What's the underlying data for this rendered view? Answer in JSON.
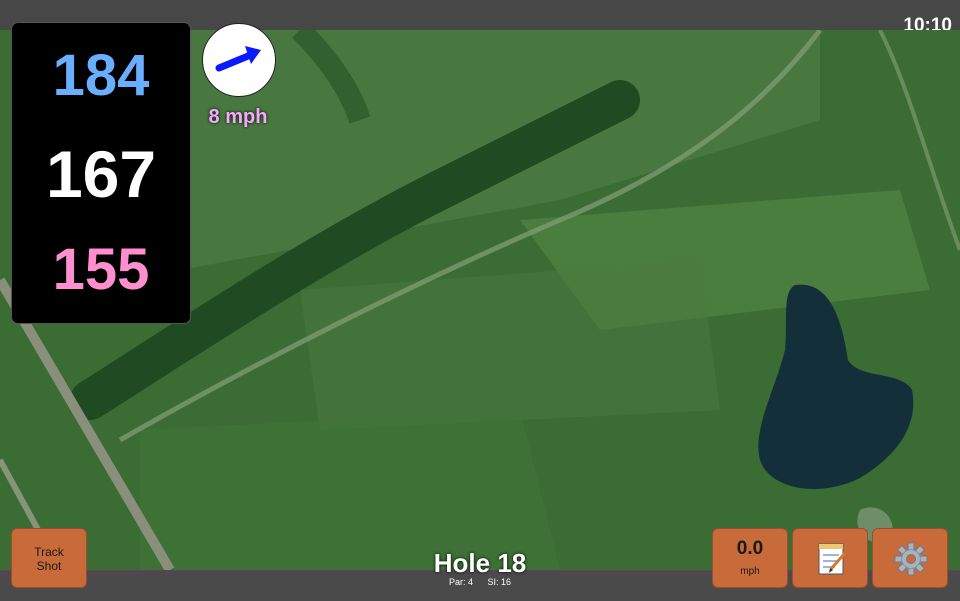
{
  "status_bar": {
    "time": "10:10"
  },
  "distances": {
    "back": "184",
    "middle": "167",
    "front": "155"
  },
  "wind": {
    "speed": "8 mph",
    "icon": "wind-arrow-icon"
  },
  "hole": {
    "title": "Hole 18",
    "par": "Par: 4",
    "stroke_index": "SI: 16"
  },
  "buttons": {
    "track_shot_line1": "Track",
    "track_shot_line2": "Shot",
    "speed_value": "0.0",
    "speed_unit": "mph",
    "notes_icon": "notepad-icon",
    "settings_icon": "gear-icon"
  },
  "colors": {
    "back_distance": "#6aaeff",
    "middle_distance": "#ffffff",
    "front_distance": "#ff8ecf",
    "button_bg": "#c96a3a",
    "wind_text": "#f6a8ff"
  }
}
